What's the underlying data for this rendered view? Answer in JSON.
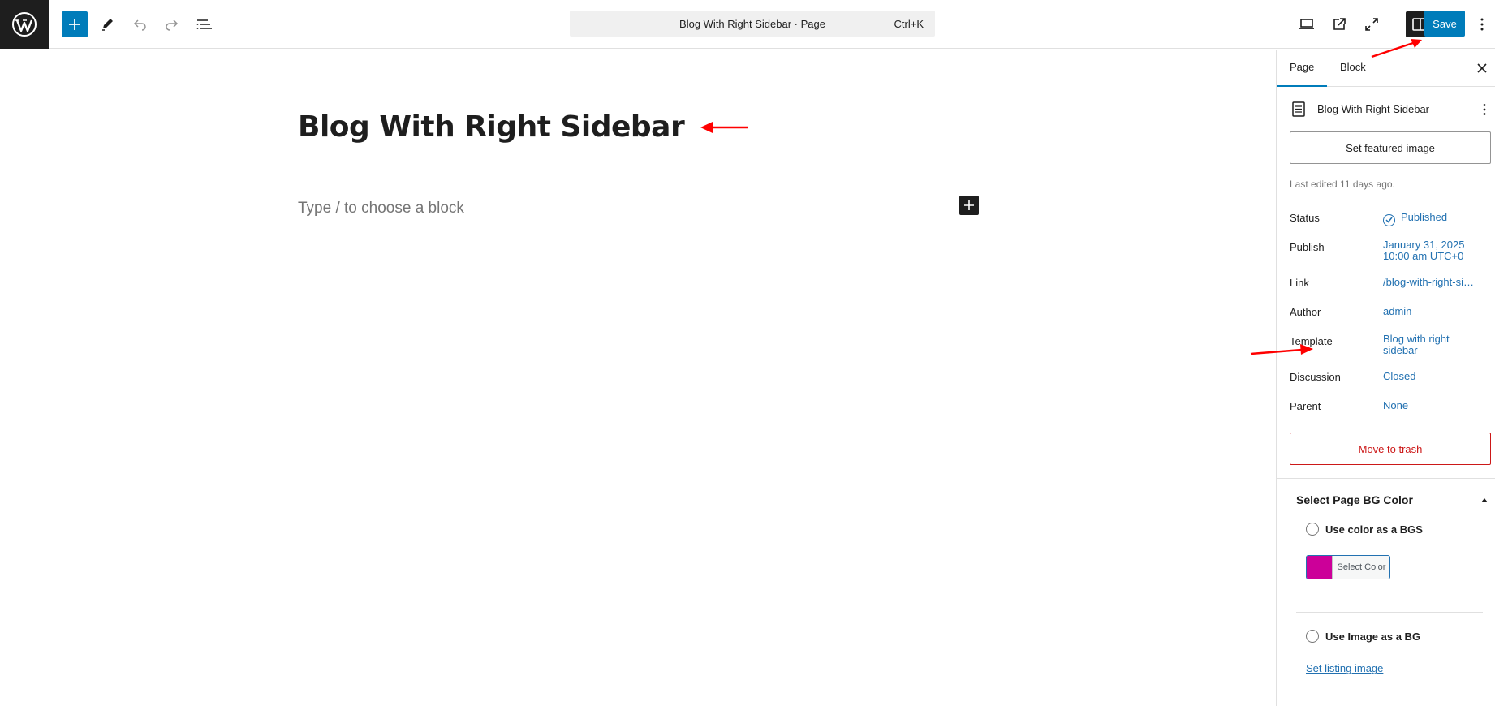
{
  "toolbar": {
    "document_title": "Blog With Right Sidebar · Page",
    "shortcut": "Ctrl+K",
    "save_label": "Save"
  },
  "editor": {
    "post_title": "Blog With Right Sidebar",
    "block_placeholder": "Type / to choose a block"
  },
  "sidebar": {
    "tabs": [
      {
        "label": "Page",
        "active": true
      },
      {
        "label": "Block",
        "active": false
      }
    ],
    "document": {
      "title": "Blog With Right Sidebar",
      "featured_image_button": "Set featured image",
      "last_edited": "Last edited 11 days ago."
    },
    "meta": {
      "status_label": "Status",
      "status_value": "Published",
      "publish_label": "Publish",
      "publish_date": "January 31, 2025",
      "publish_time": "10:00 am UTC+0",
      "link_label": "Link",
      "link_value": "/blog-with-right-si…",
      "author_label": "Author",
      "author_value": "admin",
      "template_label": "Template",
      "template_value_line1": "Blog with right",
      "template_value_line2": "sidebar",
      "discussion_label": "Discussion",
      "discussion_value": "Closed",
      "parent_label": "Parent",
      "parent_value": "None"
    },
    "trash_button": "Move to trash",
    "bg_panel": {
      "title": "Select Page BG Color",
      "option_color": "Use color as a BGS",
      "select_color_label": "Select Color",
      "swatch_color": "#cc0099",
      "option_image": "Use Image as a BG",
      "listing_link": "Set listing image"
    }
  },
  "colors": {
    "accent": "#007cba",
    "link": "#2271b1",
    "danger": "#cc1818",
    "annotation": "#ff0000"
  }
}
